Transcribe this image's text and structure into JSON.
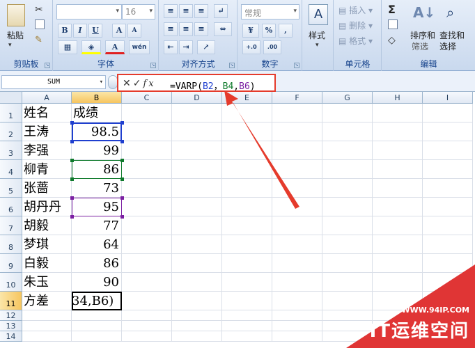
{
  "ribbon": {
    "clipboard": {
      "label": "剪贴板",
      "paste": "粘贴"
    },
    "font": {
      "label": "字体",
      "size": "16",
      "bold": "B",
      "italic": "I",
      "underline": "U",
      "grow": "A",
      "shrink": "A",
      "color": "A",
      "wen": "wén"
    },
    "alignment": {
      "label": "对齐方式"
    },
    "number": {
      "label": "数字",
      "format": "常规",
      "percent": "%",
      "comma": ",",
      "inc": "+.0",
      "dec": ".00"
    },
    "styles": {
      "label": "样式"
    },
    "cells": {
      "label": "单元格",
      "insert": "插入",
      "delete": "删除",
      "format": "格式"
    },
    "editing": {
      "label": "编辑",
      "sigma": "Σ",
      "sort": "排序和",
      "sort2": "筛选",
      "find": "查找和",
      "find2": "选择"
    }
  },
  "formula_bar": {
    "name_box": "SUM",
    "cancel": "✕",
    "enter": "✓",
    "fx": "fx",
    "formula_prefix": "=VARP(",
    "ref_b2": "B2",
    "sep1": "，",
    "ref_b4": "B4",
    "sep2": ",",
    "ref_b6": "B6",
    "formula_suffix": ")"
  },
  "columns": [
    "A",
    "B",
    "C",
    "D",
    "E",
    "F",
    "G",
    "H",
    "I"
  ],
  "rows": [
    {
      "num": "1",
      "name": "姓名",
      "score": "成绩"
    },
    {
      "num": "2",
      "name": "王涛",
      "score": "98.5"
    },
    {
      "num": "3",
      "name": "李强",
      "score": "99"
    },
    {
      "num": "4",
      "name": "柳青",
      "score": "86"
    },
    {
      "num": "5",
      "name": "张蔷",
      "score": "73"
    },
    {
      "num": "6",
      "name": "胡丹丹",
      "score": "95"
    },
    {
      "num": "7",
      "name": "胡毅",
      "score": "77"
    },
    {
      "num": "8",
      "name": "梦琪",
      "score": "64"
    },
    {
      "num": "9",
      "name": "白毅",
      "score": "86"
    },
    {
      "num": "10",
      "name": "朱玉",
      "score": "90"
    },
    {
      "num": "11",
      "name": "方差",
      "score": "34,B6)"
    },
    {
      "num": "12",
      "name": "",
      "score": ""
    },
    {
      "num": "13",
      "name": "",
      "score": ""
    },
    {
      "num": "14",
      "name": "",
      "score": ""
    }
  ],
  "watermark": {
    "url": "WWW.94IP.COM",
    "text": "IT运维空间"
  },
  "colors": {
    "ribbon": "#d5e1f2",
    "highlight_box": "#e53b2c",
    "ref_b2": "#1f3fcf",
    "ref_b4": "#0f7a2c",
    "ref_b6": "#7b1fa2",
    "selected_header": "#f6c55f"
  }
}
